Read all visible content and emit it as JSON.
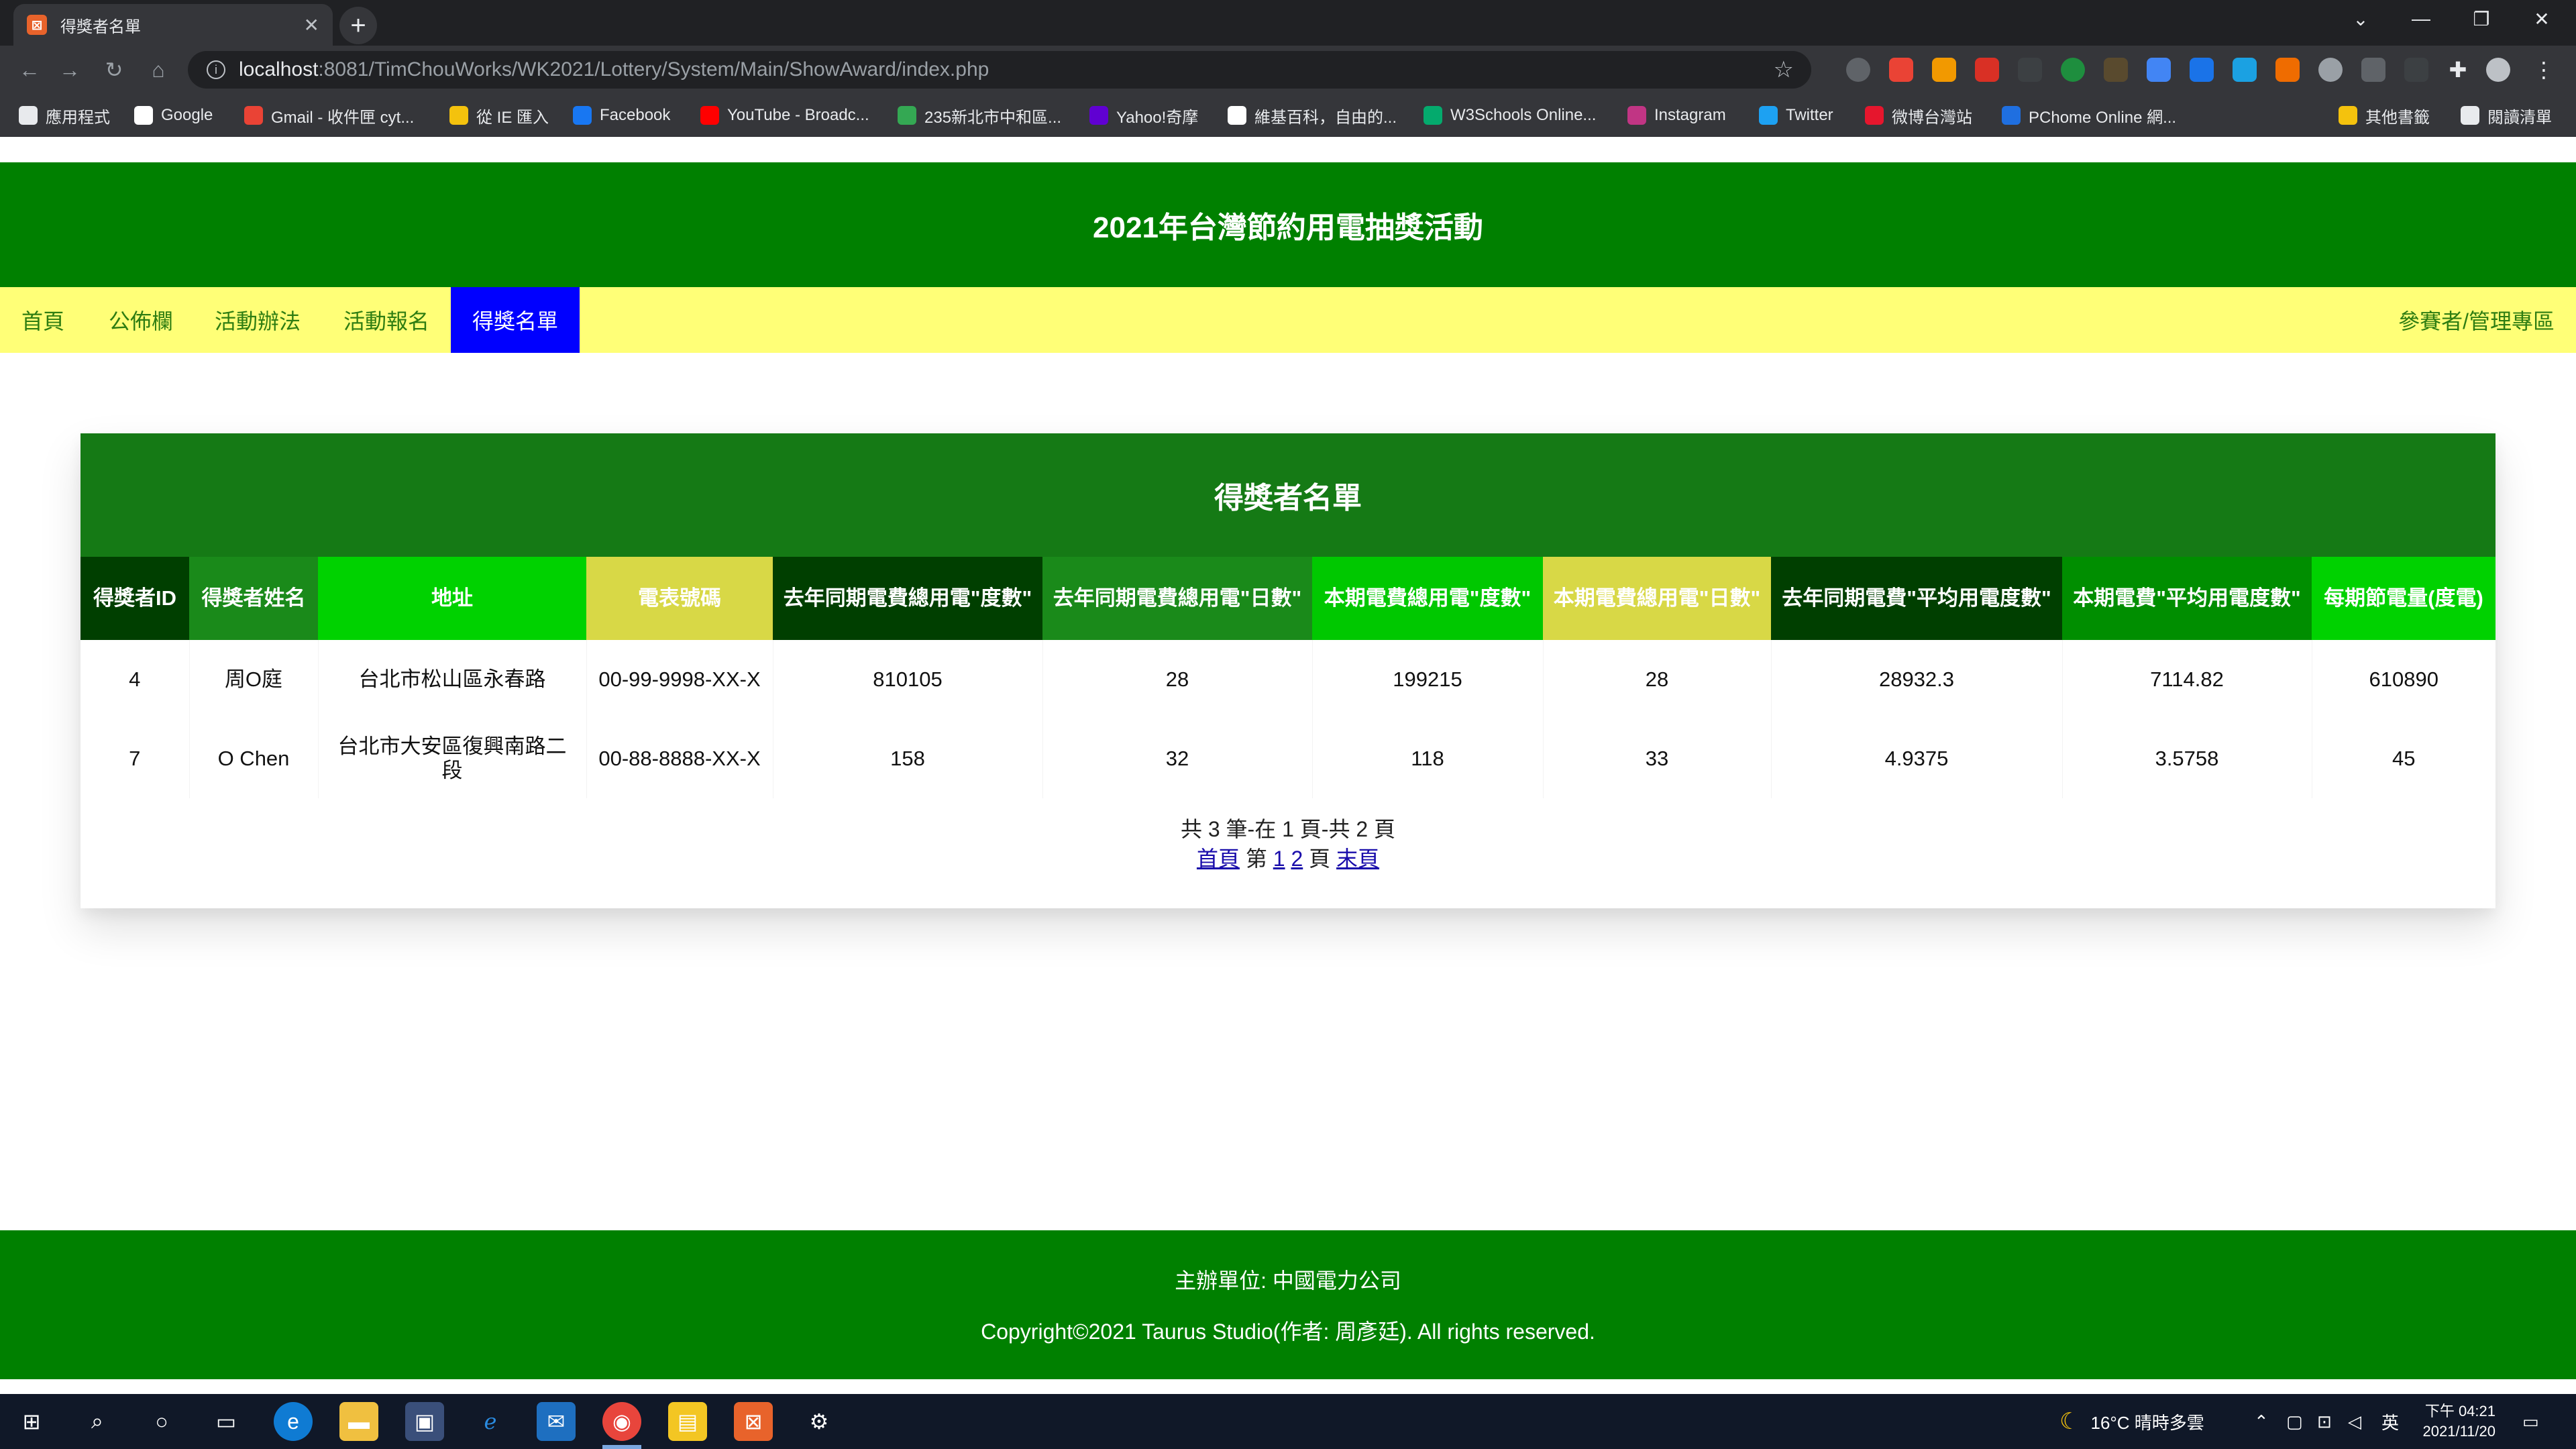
{
  "browser": {
    "tab_title": "得獎者名單",
    "tab_favicon": "⊠",
    "url_host": "localhost",
    "url_path": ":8081/TimChouWorks/WK2021/Lottery/System/Main/ShowAward/index.php",
    "bookmarks": [
      {
        "label": "應用程式",
        "color": "#e8eaed"
      },
      {
        "label": "Google",
        "color": "#ffffff"
      },
      {
        "label": "Gmail - 收件匣 cyt...",
        "color": "#ea4335"
      },
      {
        "label": "從 IE 匯入",
        "color": "#f4c20d"
      },
      {
        "label": "Facebook",
        "color": "#1877f2"
      },
      {
        "label": "YouTube - Broadc...",
        "color": "#ff0000"
      },
      {
        "label": "235新北市中和區...",
        "color": "#34a853"
      },
      {
        "label": "Yahoo!奇摩",
        "color": "#6001d2"
      },
      {
        "label": "維基百科，自由的...",
        "color": "#ffffff"
      },
      {
        "label": "W3Schools Online...",
        "color": "#04aa6d"
      },
      {
        "label": "Instagram",
        "color": "#c13584"
      },
      {
        "label": "Twitter",
        "color": "#1da1f2"
      },
      {
        "label": "微博台灣站",
        "color": "#e6162d"
      },
      {
        "label": "PChome Online 網...",
        "color": "#1f6fe0"
      },
      {
        "label": "其他書籤",
        "color": "#f4c20d"
      },
      {
        "label": "閱讀清單",
        "color": "#e8eaed"
      }
    ]
  },
  "site": {
    "title": "2021年台灣節約用電抽獎活動",
    "nav": [
      "首頁",
      "公佈欄",
      "活動辦法",
      "活動報名",
      "得獎名單"
    ],
    "nav_right": "參賽者/管理專區"
  },
  "award": {
    "title": "得獎者名單",
    "headers": [
      "得獎者ID",
      "得獎者姓名",
      "地址",
      "電表號碼",
      "去年同期電費總用電\"度數\"",
      "去年同期電費總用電\"日數\"",
      "本期電費總用電\"度數\"",
      "本期電費總用電\"日數\"",
      "去年同期電費\"平均用電度數\"",
      "本期電費\"平均用電度數\"",
      "每期節電量(度電)"
    ],
    "header_colors": [
      "#003f00",
      "#1a8a1a",
      "#00d200",
      "#d8d846",
      "#003f00",
      "#1a8a1a",
      "#00c800",
      "#d8d846",
      "#003f00",
      "#008e00",
      "#00d200"
    ],
    "rows": [
      [
        "4",
        "周O庭",
        "台北市松山區永春路",
        "00-99-9998-XX-X",
        "810105",
        "28",
        "199215",
        "28",
        "28932.3",
        "7114.82",
        "610890"
      ],
      [
        "7",
        "O Chen",
        "台北市大安區復興南路二段",
        "00-88-8888-XX-X",
        "158",
        "32",
        "118",
        "33",
        "4.9375",
        "3.5758",
        "45"
      ]
    ],
    "pager": {
      "summary": "共 3 筆-在 1 頁-共 2 頁",
      "first": "首頁",
      "page_word": "第",
      "pages": [
        "1",
        "2"
      ],
      "page_suffix": "頁",
      "last": "末頁"
    }
  },
  "footer": {
    "organizer": "主辦單位: 中國電力公司",
    "copyright": "Copyright©2021 Taurus Studio(作者: 周彥廷). All rights reserved."
  },
  "taskbar": {
    "weather": "16°C  晴時多雲",
    "ime": "英",
    "time": "下午 04:21",
    "date": "2021/11/20"
  }
}
